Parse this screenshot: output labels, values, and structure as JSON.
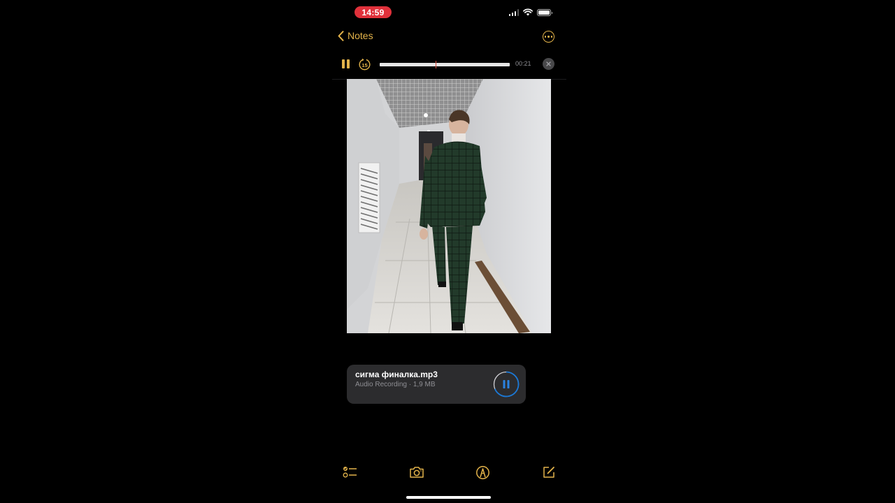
{
  "status_bar": {
    "time": "14:59",
    "icons": [
      "cellular-signal-icon",
      "wifi-icon",
      "battery-icon"
    ]
  },
  "nav": {
    "back_label": "Notes",
    "back_icon": "chevron-left-icon",
    "more_icon": "ellipsis-circle-icon"
  },
  "player": {
    "pause_icon": "pause-icon",
    "skip_back_seconds": "15",
    "elapsed": "00:21",
    "progress": 0.43,
    "close_icon": "close-icon"
  },
  "note": {
    "image_description": "Photo of a man in a green plaid suit walking down a white hallway with a marble floor"
  },
  "attachment": {
    "title": "сигма финалка.mp3",
    "subtitle": "Audio Recording · 1,9 MB",
    "state": "playing",
    "button_icon": "pause-icon"
  },
  "toolbar": {
    "items": [
      {
        "name": "checklist",
        "icon": "checklist-icon"
      },
      {
        "name": "camera",
        "icon": "camera-icon"
      },
      {
        "name": "markup",
        "icon": "markup-pen-icon"
      },
      {
        "name": "compose",
        "icon": "compose-icon"
      }
    ]
  },
  "colors": {
    "accent": "#e3b34a",
    "status_pill": "#e0313b",
    "attachment_bg": "#2c2c2e",
    "play_ring": "#1a78d6",
    "playhead": "#d24a3a"
  }
}
